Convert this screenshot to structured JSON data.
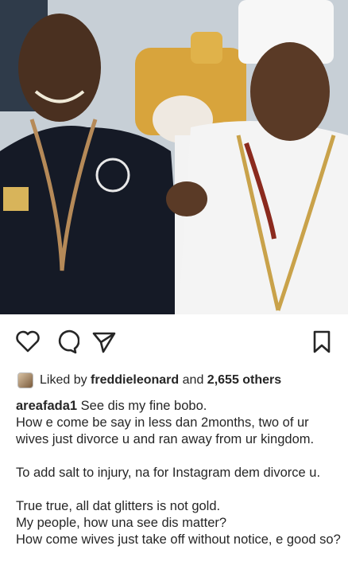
{
  "post": {
    "image_alt": "Two men smiling; one holds a white ceremonial staff",
    "icons": {
      "like": "heart-icon",
      "comment": "comment-icon",
      "share": "send-icon",
      "save": "bookmark-icon"
    },
    "likes": {
      "prefix": "Liked by",
      "user": "freddieleonard",
      "connector": "and",
      "others": "2,655 others"
    },
    "caption": {
      "username": "areafada1",
      "lines": [
        "See dis my fine bobo.",
        "How e come be say in less dan 2months, two of ur wives just divorce u and ran away from ur kingdom.",
        "",
        "To add salt to injury, na for Instagram dem divorce u.",
        "",
        "True true, all dat glitters is not gold.",
        "My people, how una see dis matter?",
        "How come wives just take off without notice, e good so?"
      ]
    }
  }
}
